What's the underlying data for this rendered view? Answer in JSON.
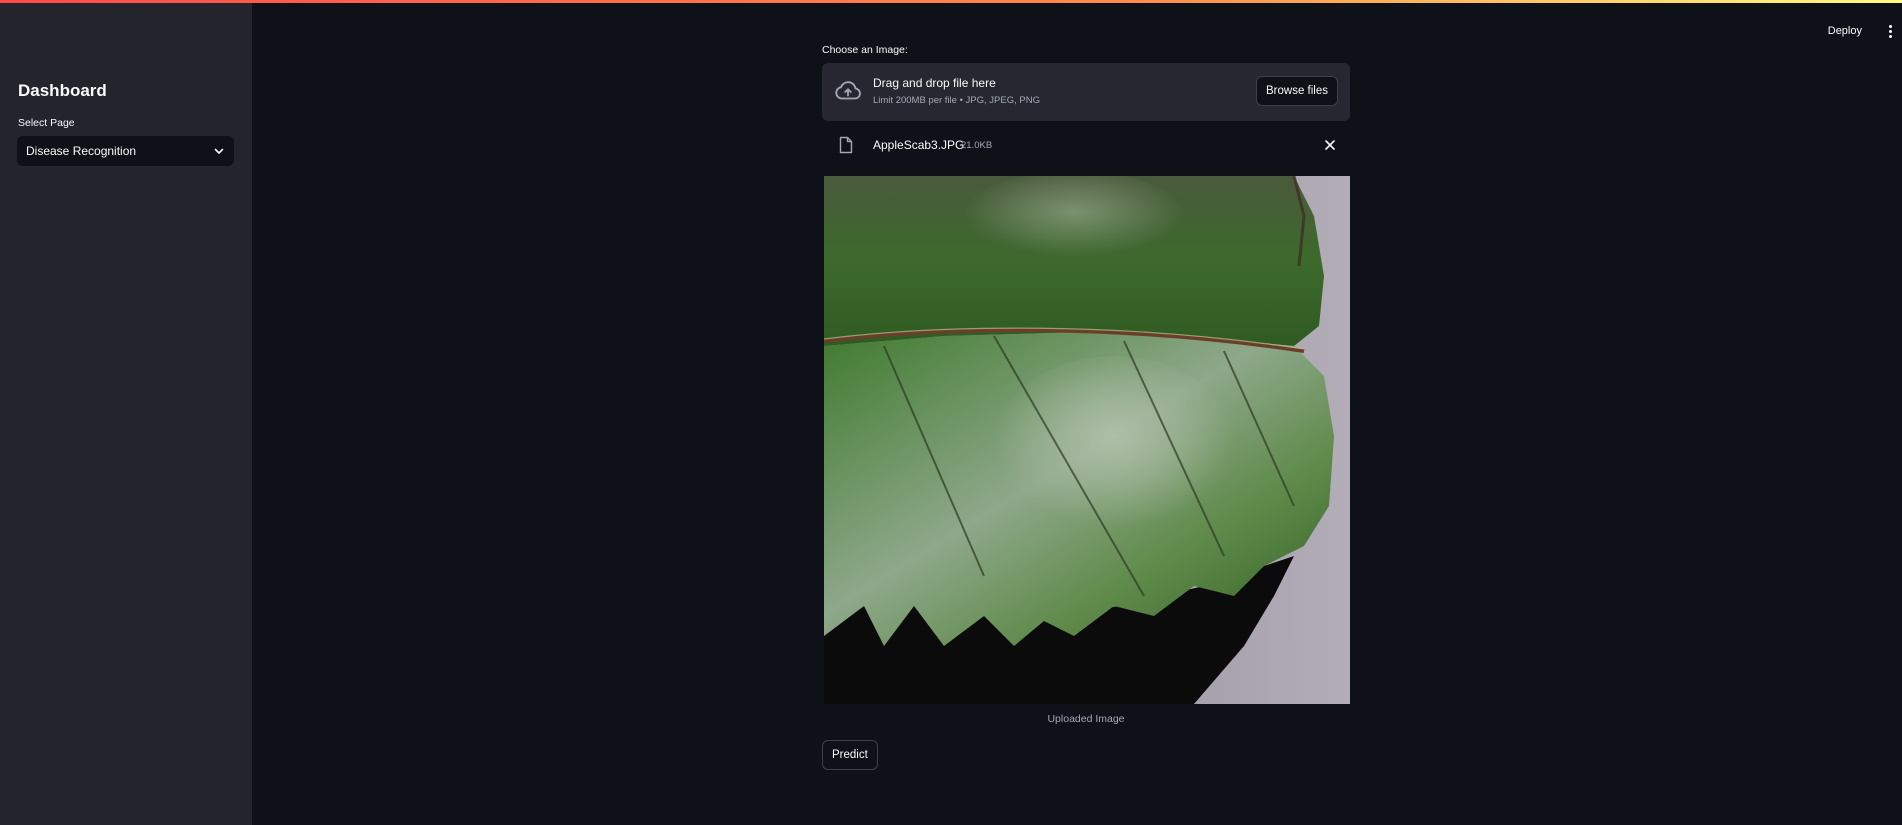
{
  "header": {
    "deploy_label": "Deploy",
    "menu_icon": "kebab-menu-icon"
  },
  "sidebar": {
    "title": "Dashboard",
    "select_label": "Select Page",
    "select_value": "Disease Recognition",
    "select_icon": "chevron-down-icon"
  },
  "main": {
    "uploader_label": "Choose an Image:",
    "dropzone": {
      "icon": "cloud-upload-icon",
      "title": "Drag and drop file here",
      "subtitle": "Limit 200MB per file • JPG, JPEG, PNG",
      "browse_label": "Browse files"
    },
    "file": {
      "icon": "file-icon",
      "name": "AppleScab3.JPG",
      "size": "21.0KB",
      "remove_icon": "close-icon"
    },
    "image_caption": "Uploaded Image",
    "predict_label": "Predict"
  },
  "colors": {
    "background": "#0e1117",
    "sidebar": "#23242c",
    "widget": "#262730",
    "accent_gradient_start": "#ff4b4b",
    "accent_gradient_end": "#fffd80"
  }
}
